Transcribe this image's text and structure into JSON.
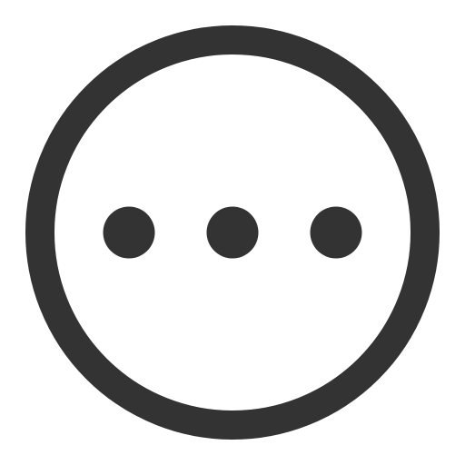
{
  "icon": {
    "name": "more-options-icon",
    "glyph": "circle-with-three-dots",
    "color": "#333333",
    "background": "#ffffff"
  }
}
